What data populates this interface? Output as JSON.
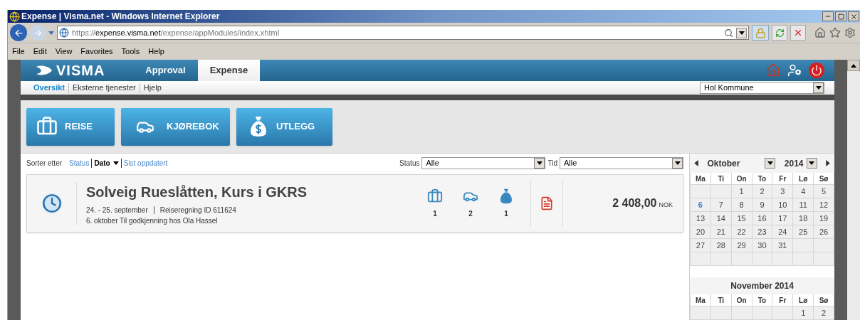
{
  "window": {
    "title": "Expense | Visma.net - Windows Internet Explorer"
  },
  "address_bar": {
    "scheme": "https://",
    "host": "expense.visma.net",
    "path": "/expense/appModules/index.xhtml"
  },
  "menu": [
    "File",
    "Edit",
    "View",
    "Favorites",
    "Tools",
    "Help"
  ],
  "app": {
    "logo": "VISMA",
    "tabs": [
      {
        "label": "Approval",
        "selected": false
      },
      {
        "label": "Expense",
        "selected": true
      }
    ],
    "subnav": [
      {
        "label": "Oversikt",
        "selected": true
      },
      {
        "label": "Eksterne tjenester",
        "selected": false
      },
      {
        "label": "Hjelp",
        "selected": false
      }
    ],
    "company": "Hol Kommune"
  },
  "actions": [
    {
      "kind": "suitcase",
      "label": "REISE"
    },
    {
      "kind": "car",
      "label": "KJØREBOK"
    },
    {
      "kind": "moneybag",
      "label": "UTLEGG"
    }
  ],
  "sort": {
    "label": "Sorter etter",
    "options": [
      {
        "label": "Status",
        "selected": false
      },
      {
        "label": "Dato",
        "selected": true
      },
      {
        "label": "Sist oppdatert",
        "selected": false
      }
    ]
  },
  "filters": [
    {
      "label": "Status",
      "value": "Alle"
    },
    {
      "label": "Tid",
      "value": "Alle"
    }
  ],
  "cards": [
    {
      "title": "Solveig Rueslåtten, Kurs i GKRS",
      "dates": "24. - 25. september",
      "report_id": "Reiseregning ID 611624",
      "status": "6. oktober Til godkjenning hos Ola Hassel",
      "counts": [
        {
          "kind": "suitcase",
          "count": "1"
        },
        {
          "kind": "car",
          "count": "2"
        },
        {
          "kind": "moneybag",
          "count": "1"
        }
      ],
      "amount": "2 408,00",
      "currency": "NOK"
    }
  ],
  "calendar": {
    "month": "Oktober",
    "year": "2014",
    "weekdays": [
      "Ma",
      "Ti",
      "On",
      "To",
      "Fr",
      "Lø",
      "Sø"
    ],
    "weeks": [
      [
        {
          "kind": "empty"
        },
        {
          "kind": "empty"
        },
        {
          "kind": "day",
          "day": "1",
          "today": false
        },
        {
          "kind": "day",
          "day": "2",
          "today": false
        },
        {
          "kind": "day",
          "day": "3",
          "today": false
        },
        {
          "kind": "day",
          "day": "4",
          "today": false
        },
        {
          "kind": "day",
          "day": "5",
          "today": false
        }
      ],
      [
        {
          "kind": "day",
          "day": "6",
          "today": true
        },
        {
          "kind": "day",
          "day": "7",
          "today": false
        },
        {
          "kind": "day",
          "day": "8",
          "today": false
        },
        {
          "kind": "day",
          "day": "9",
          "today": false
        },
        {
          "kind": "day",
          "day": "10",
          "today": false
        },
        {
          "kind": "day",
          "day": "11",
          "today": false
        },
        {
          "kind": "day",
          "day": "12",
          "today": false
        }
      ],
      [
        {
          "kind": "day",
          "day": "13",
          "today": false
        },
        {
          "kind": "day",
          "day": "14",
          "today": false
        },
        {
          "kind": "day",
          "day": "15",
          "today": false
        },
        {
          "kind": "day",
          "day": "16",
          "today": false
        },
        {
          "kind": "day",
          "day": "17",
          "today": false
        },
        {
          "kind": "day",
          "day": "18",
          "today": false
        },
        {
          "kind": "day",
          "day": "19",
          "today": false
        }
      ],
      [
        {
          "kind": "day",
          "day": "20",
          "today": false
        },
        {
          "kind": "day",
          "day": "21",
          "today": false
        },
        {
          "kind": "day",
          "day": "22",
          "today": false
        },
        {
          "kind": "day",
          "day": "23",
          "today": false
        },
        {
          "kind": "day",
          "day": "24",
          "today": false
        },
        {
          "kind": "day",
          "day": "25",
          "today": false
        },
        {
          "kind": "day",
          "day": "26",
          "today": false
        }
      ],
      [
        {
          "kind": "day",
          "day": "27",
          "today": false
        },
        {
          "kind": "day",
          "day": "28",
          "today": false
        },
        {
          "kind": "day",
          "day": "29",
          "today": false
        },
        {
          "kind": "day",
          "day": "30",
          "today": false
        },
        {
          "kind": "day",
          "day": "31",
          "today": false
        },
        {
          "kind": "empty"
        },
        {
          "kind": "empty"
        }
      ],
      [
        {
          "kind": "empty"
        },
        {
          "kind": "empty"
        },
        {
          "kind": "empty"
        },
        {
          "kind": "empty"
        },
        {
          "kind": "empty"
        },
        {
          "kind": "empty"
        },
        {
          "kind": "empty"
        }
      ]
    ],
    "next_title": "November 2014",
    "next_weekdays": [
      "Ma",
      "Ti",
      "On",
      "To",
      "Fr",
      "Lø",
      "Sø"
    ],
    "next_weeks": [
      [
        {
          "kind": "empty"
        },
        {
          "kind": "empty"
        },
        {
          "kind": "empty"
        },
        {
          "kind": "empty"
        },
        {
          "kind": "empty"
        },
        {
          "kind": "day",
          "day": "1",
          "today": false
        },
        {
          "kind": "day",
          "day": "2",
          "today": false
        }
      ]
    ]
  }
}
